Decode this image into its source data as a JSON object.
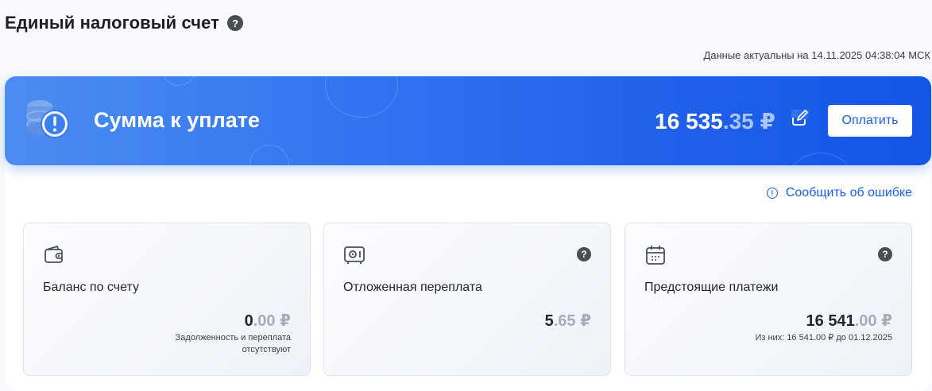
{
  "header": {
    "title": "Единый налоговый счет",
    "help": "?",
    "actual_note": "Данные актуальны на 14.11.2025 04:38:04 МСК"
  },
  "banner": {
    "title": "Сумма к уплате",
    "amount_int": "16 535",
    "amount_cents": ".35",
    "currency": "₽",
    "pay_label": "Оплатить",
    "icons": [
      "coins-alert-icon",
      "edit-icon"
    ],
    "colors": {
      "start": "#4b8df0",
      "end": "#1356e6"
    }
  },
  "report_link": {
    "icon": "!",
    "label": "Сообщить об ошибке"
  },
  "cards": [
    {
      "icon": "wallet-icon",
      "title": "Баланс по счету",
      "amount_int": "0",
      "amount_cents": ".00",
      "currency": "₽",
      "sub": [
        "Задолженность и переплата",
        "отсутствуют"
      ]
    },
    {
      "icon": "safe-icon",
      "help": "?",
      "title": "Отложенная переплата",
      "amount_int": "5",
      "amount_cents": ".65",
      "currency": "₽"
    },
    {
      "icon": "calendar-icon",
      "help": "?",
      "title": "Предстоящие платежи",
      "amount_int": "16 541",
      "amount_cents": ".00",
      "currency": "₽",
      "sub": [
        "Из них: 16 541.00 ₽ до 01.12.2025"
      ]
    }
  ],
  "accent_color": "#1a5fe6"
}
